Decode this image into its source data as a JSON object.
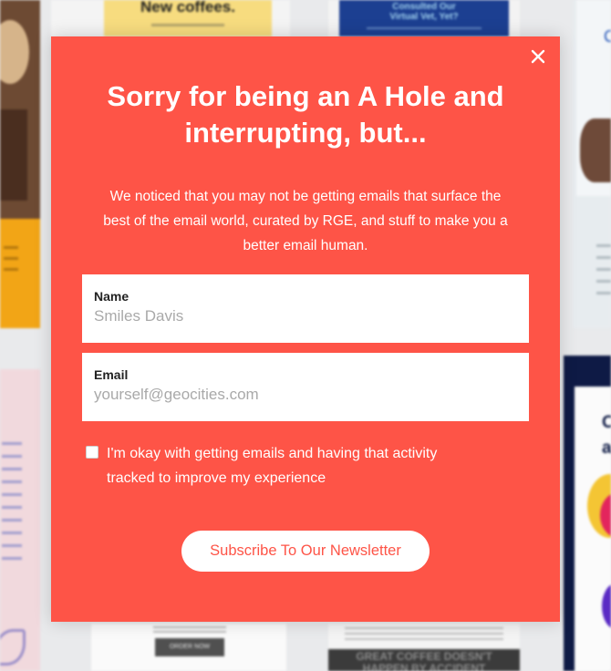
{
  "background": {
    "coffee_card_title": "New coffees.",
    "vet_card_title": [
      "Consulted Our",
      "Virtual Vet, Yet?"
    ],
    "right_card_text": [
      "Op",
      "a"
    ],
    "order_button": "ORDER NOW",
    "dark_banner": [
      "GREAT COFFEE DOESN'T",
      "HAPPEN BY ACCIDENT"
    ]
  },
  "modal": {
    "background_color": "#fe5447",
    "close_icon": "close-icon",
    "title_lines": [
      "Sorry for being an A Hole and",
      "interrupting, but..."
    ],
    "description_lines": [
      "We noticed that you may not be getting emails that surface the",
      "best of the email world, curated by RGE, and stuff to make you a",
      "better email human."
    ],
    "name_field": {
      "label": "Name",
      "placeholder": "Smiles Davis"
    },
    "email_field": {
      "label": "Email",
      "placeholder": "yourself@geocities.com"
    },
    "consent": {
      "checked": false,
      "lines": [
        "I'm okay with getting emails and having that activity",
        "tracked to improve my experience"
      ]
    },
    "subscribe_button": "Subscribe To Our Newsletter"
  }
}
